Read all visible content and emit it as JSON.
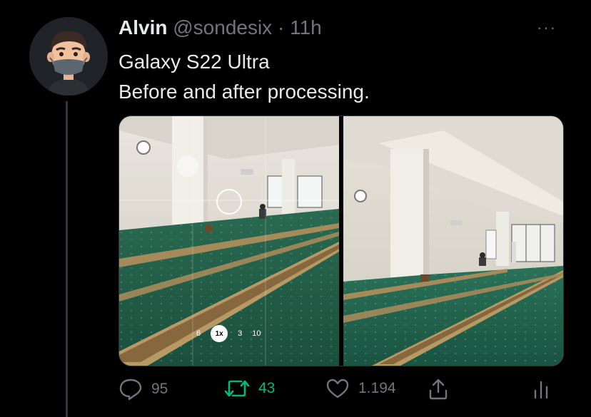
{
  "tweet": {
    "author_name": "Alvin",
    "handle": "@sondesix",
    "separator": "·",
    "time": "11h",
    "more_label": "···",
    "text_line1": "Galaxy S22 Ultra",
    "text_line2": "Before and after processing."
  },
  "media": {
    "camera_zoom_options": [
      "6",
      "1x",
      "3",
      "10"
    ],
    "camera_zoom_selected": "1x"
  },
  "actions": {
    "replies": "95",
    "retweets": "43",
    "likes": "1.194"
  },
  "colors": {
    "background": "#000000",
    "text": "#e7e9ea",
    "muted": "#71767b",
    "retweet_accent": "#00ba7c",
    "carpet_green": "#1e5a46"
  }
}
